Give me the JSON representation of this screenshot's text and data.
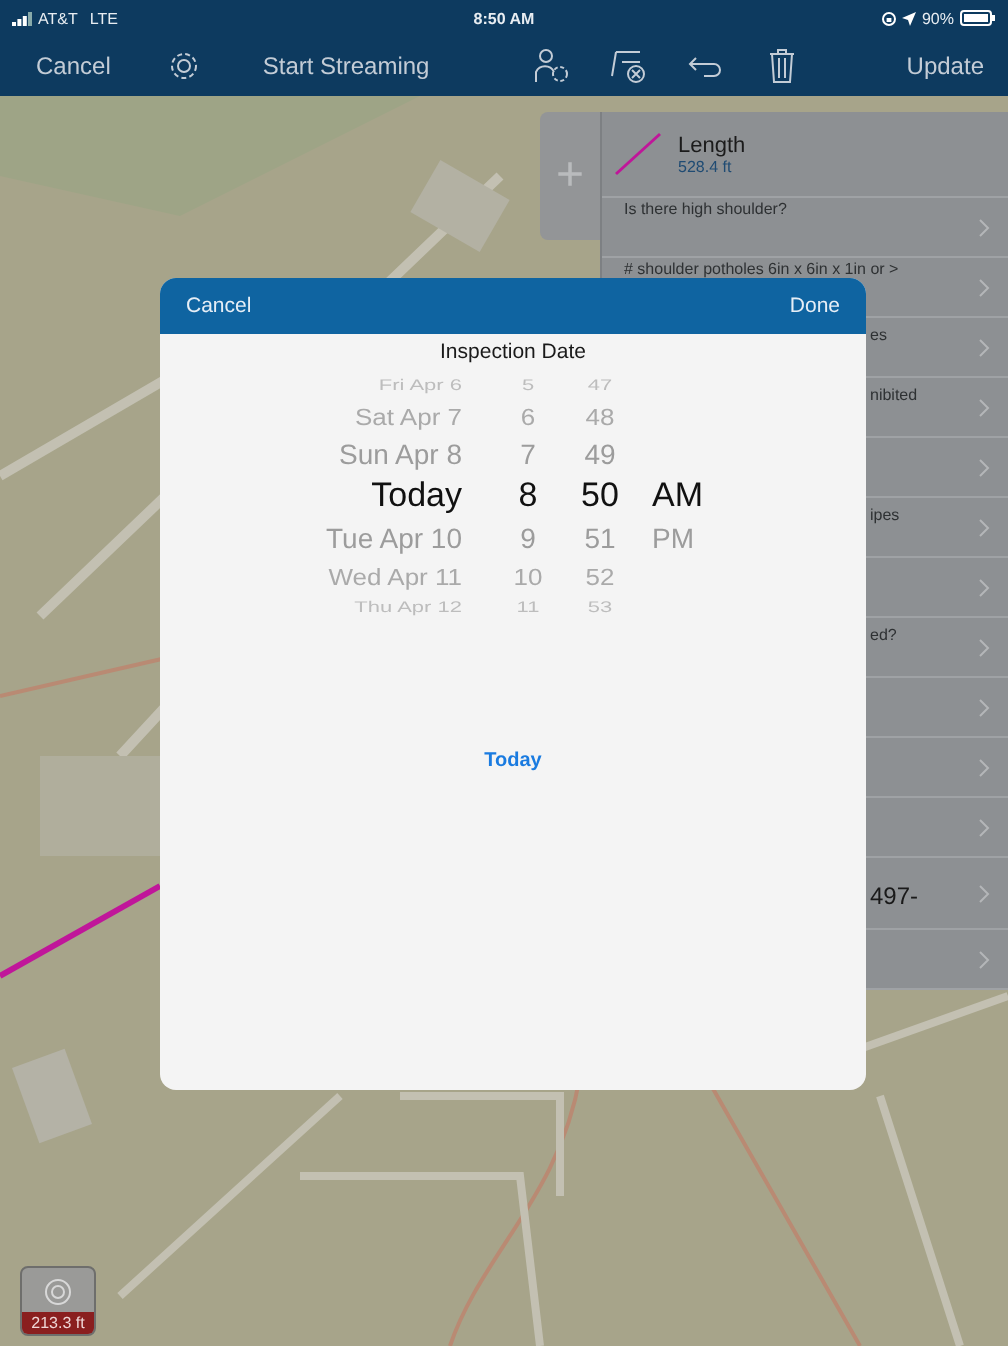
{
  "status_bar": {
    "carrier": "AT&T",
    "network": "LTE",
    "time": "8:50 AM",
    "battery": "90%"
  },
  "toolbar": {
    "cancel": "Cancel",
    "streaming": "Start Streaming",
    "update": "Update"
  },
  "map": {
    "kind": "picture",
    "scale": "213.3 ft"
  },
  "feature_panel": {
    "add": "+",
    "title": "Length",
    "value": "528.4 ft",
    "rows": [
      {
        "kind": "question",
        "text": "Is there high shoulder?"
      },
      {
        "kind": "question",
        "text": "# shoulder potholes 6in x 6in x 1in or >"
      },
      {
        "kind": "partial",
        "text": "es"
      },
      {
        "kind": "partial",
        "text": "nibited"
      },
      {
        "kind": "empty"
      },
      {
        "kind": "partial",
        "text": "ipes"
      },
      {
        "kind": "empty"
      },
      {
        "kind": "partial",
        "text": "ed?"
      },
      {
        "kind": "empty"
      },
      {
        "kind": "empty"
      },
      {
        "kind": "empty"
      },
      {
        "kind": "value",
        "text": "497-"
      },
      {
        "kind": "empty"
      }
    ]
  },
  "picker": {
    "cancel": "Cancel",
    "done": "Done",
    "title": "Inspection Date",
    "today_button": "Today",
    "days": [
      {
        "label": "Fri Apr 6",
        "selected": false
      },
      {
        "label": "Sat Apr 7",
        "selected": false
      },
      {
        "label": "Sun Apr 8",
        "selected": false
      },
      {
        "label": "Today",
        "selected": true
      },
      {
        "label": "Tue Apr 10",
        "selected": false
      },
      {
        "label": "Wed Apr 11",
        "selected": false
      },
      {
        "label": "Thu Apr 12",
        "selected": false
      }
    ],
    "hours": [
      {
        "label": "5",
        "selected": false
      },
      {
        "label": "6",
        "selected": false
      },
      {
        "label": "7",
        "selected": false
      },
      {
        "label": "8",
        "selected": true
      },
      {
        "label": "9",
        "selected": false
      },
      {
        "label": "10",
        "selected": false
      },
      {
        "label": "11",
        "selected": false
      }
    ],
    "minutes": [
      {
        "label": "47",
        "selected": false
      },
      {
        "label": "48",
        "selected": false
      },
      {
        "label": "49",
        "selected": false
      },
      {
        "label": "50",
        "selected": true
      },
      {
        "label": "51",
        "selected": false
      },
      {
        "label": "52",
        "selected": false
      },
      {
        "label": "53",
        "selected": false
      }
    ],
    "periods": [
      {
        "label": "AM",
        "selected": true
      },
      {
        "label": "PM",
        "selected": false
      }
    ]
  }
}
